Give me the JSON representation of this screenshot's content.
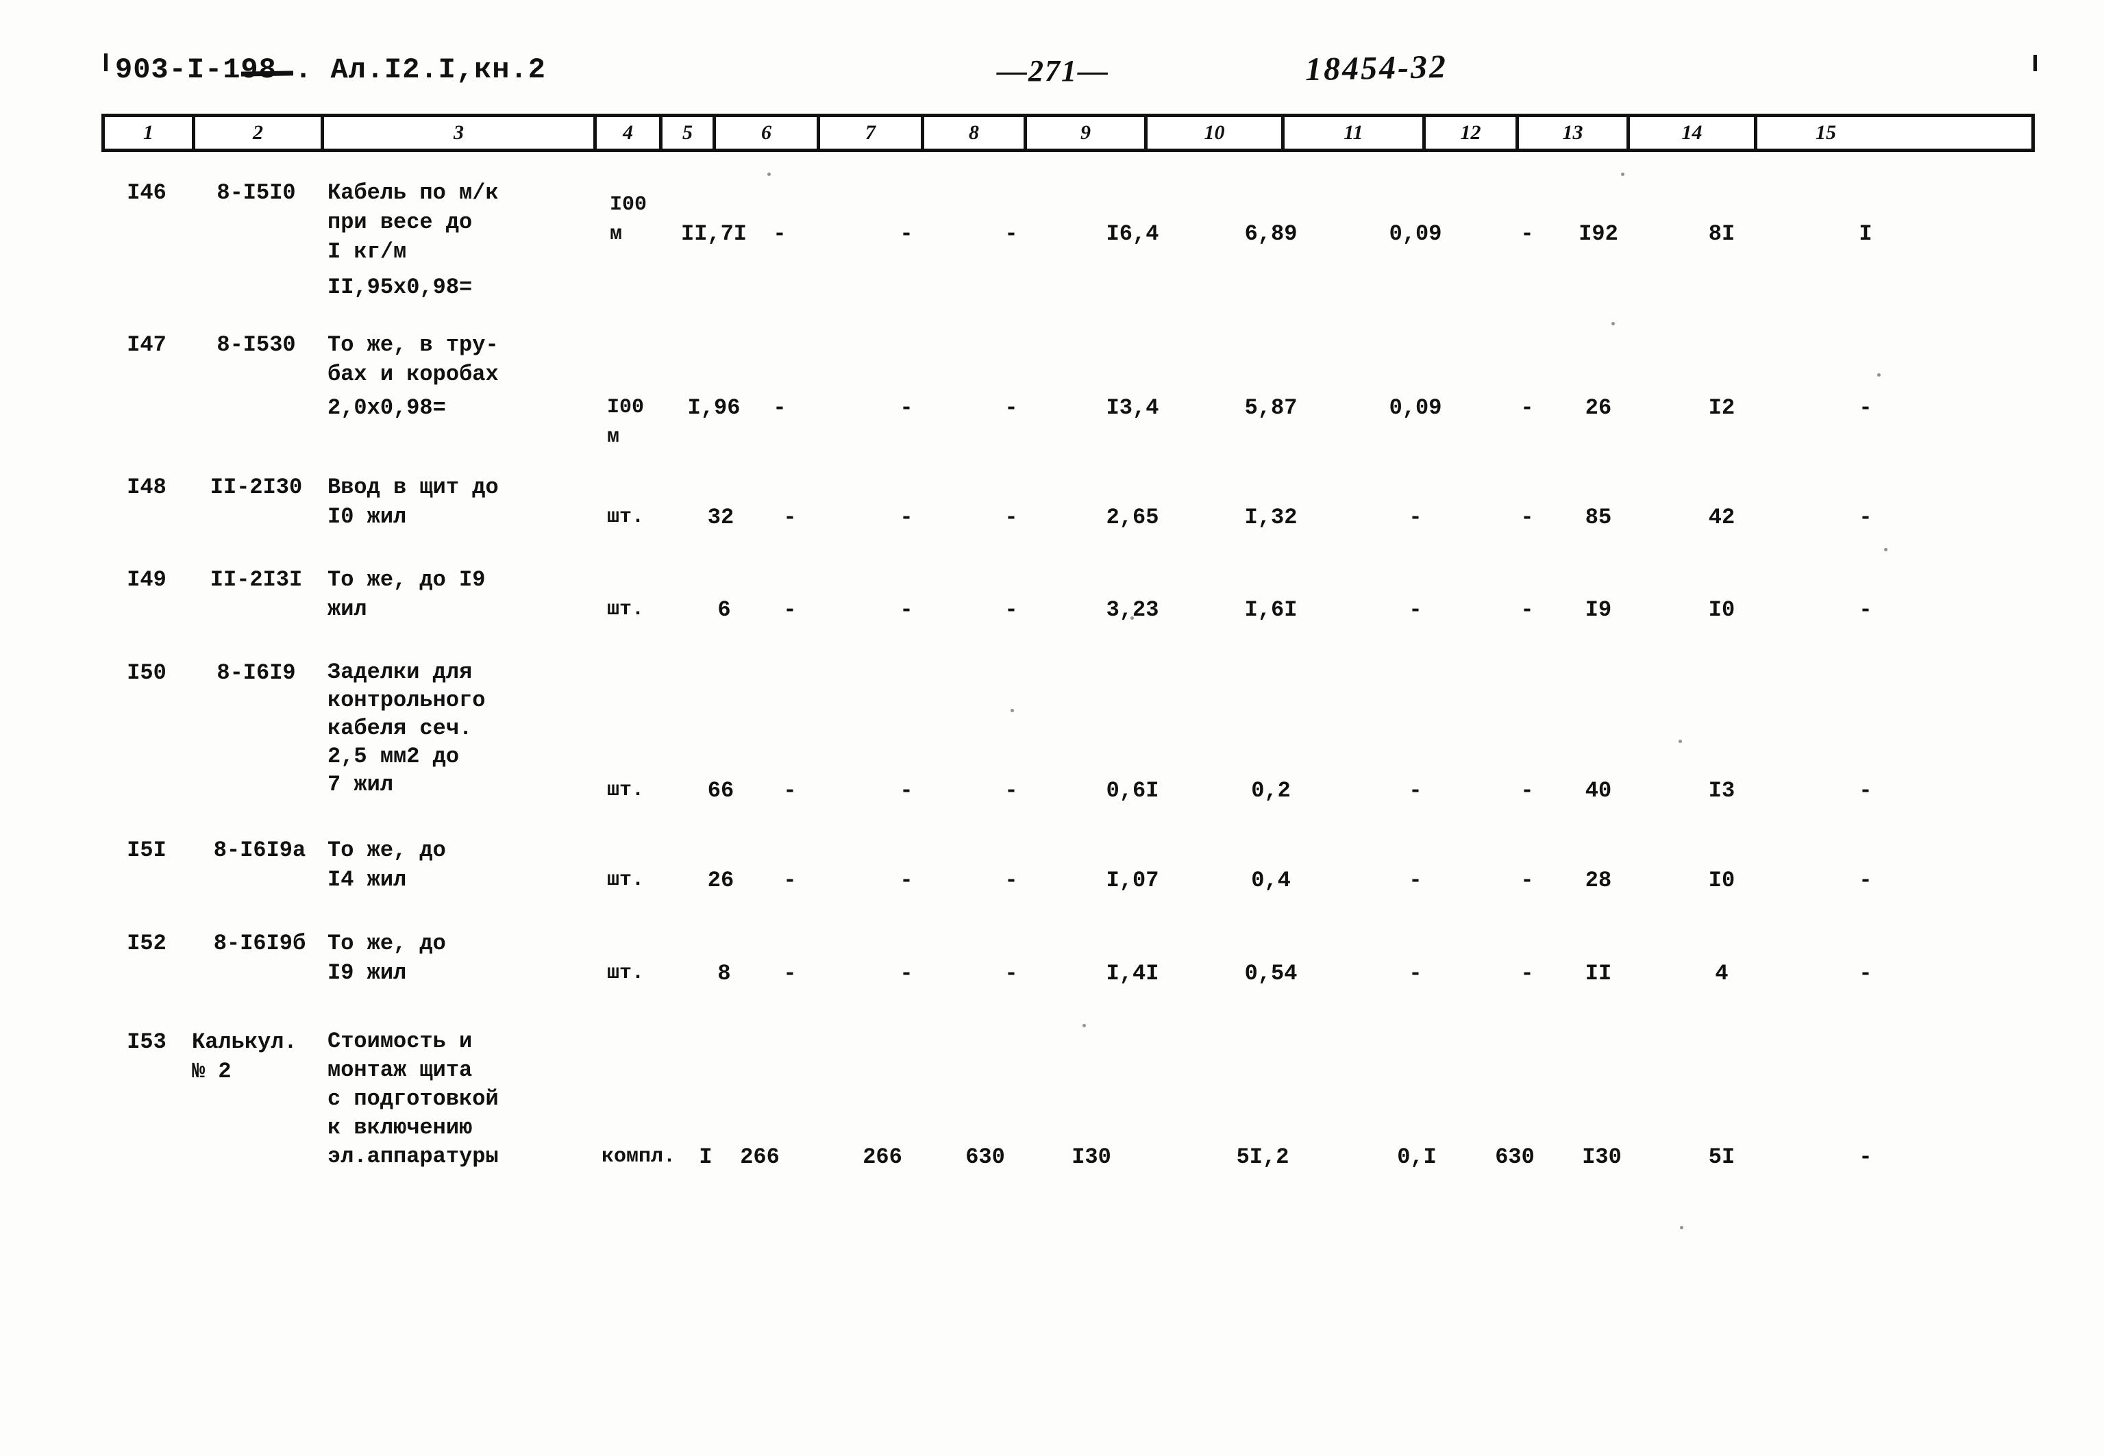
{
  "header": {
    "doc_code": "903-I-198 . Ал.I2.I,кн.2",
    "page_number": "—271—",
    "stamp": "18454-32"
  },
  "table": {
    "column_headers": [
      "1",
      "2",
      "3",
      "4",
      "5",
      "6",
      "7",
      "8",
      "9",
      "10",
      "11",
      "12",
      "13",
      "14",
      "15"
    ],
    "rows": [
      {
        "pos": "I46",
        "code": "8-I5I0",
        "description": "Кабель по м/к\nпри весе до\nI кг/м",
        "formula": "II,95х0,98=",
        "unit": "I00\nм",
        "qty": "II,7I",
        "c6": "-",
        "c7": "-",
        "c8": "-",
        "c9": "I6,4",
        "c10": "6,89",
        "c11": "0,09",
        "c12": "-",
        "c13": "I92",
        "c14": "8I",
        "c15": "I"
      },
      {
        "pos": "I47",
        "code": "8-I530",
        "description": "То же, в тру-\nбах и коробах",
        "formula": "2,0х0,98=",
        "unit": "I00\nм",
        "qty": "I,96",
        "c6": "-",
        "c7": "-",
        "c8": "-",
        "c9": "I3,4",
        "c10": "5,87",
        "c11": "0,09",
        "c12": "-",
        "c13": "26",
        "c14": "I2",
        "c15": "-"
      },
      {
        "pos": "I48",
        "code": "II-2I30",
        "description": "Ввод в щит до\nI0 жил",
        "formula": "",
        "unit": "шт.",
        "qty": "32",
        "c6": "-",
        "c7": "-",
        "c8": "-",
        "c9": "2,65",
        "c10": "I,32",
        "c11": "-",
        "c12": "-",
        "c13": "85",
        "c14": "42",
        "c15": "-"
      },
      {
        "pos": "I49",
        "code": "II-2I3I",
        "description": "То же, до I9\nжил",
        "formula": "",
        "unit": "шт.",
        "qty": "6",
        "c6": "-",
        "c7": "-",
        "c8": "-",
        "c9": "3,23",
        "c10": "I,6I",
        "c11": "-",
        "c12": "-",
        "c13": "I9",
        "c14": "I0",
        "c15": "-"
      },
      {
        "pos": "I50",
        "code": "8-I6I9",
        "description": "Заделки для\nконтрольного\nкабеля сеч.\n2,5 мм2 до\n7 жил",
        "formula": "",
        "unit": "шт.",
        "qty": "66",
        "c6": "-",
        "c7": "-",
        "c8": "-",
        "c9": "0,6I",
        "c10": "0,2",
        "c11": "-",
        "c12": "-",
        "c13": "40",
        "c14": "I3",
        "c15": "-"
      },
      {
        "pos": "I5I",
        "code": "8-I6I9а",
        "description": "То же, до\nI4 жил",
        "formula": "",
        "unit": "шт.",
        "qty": "26",
        "c6": "-",
        "c7": "-",
        "c8": "-",
        "c9": "I,07",
        "c10": "0,4",
        "c11": "-",
        "c12": "-",
        "c13": "28",
        "c14": "I0",
        "c15": "-"
      },
      {
        "pos": "I52",
        "code": "8-I6I9б",
        "description": "То же, до\nI9 жил",
        "formula": "",
        "unit": "шт.",
        "qty": "8",
        "c6": "-",
        "c7": "-",
        "c8": "-",
        "c9": "I,4I",
        "c10": "0,54",
        "c11": "-",
        "c12": "-",
        "c13": "II",
        "c14": "4",
        "c15": "-"
      },
      {
        "pos": "I53",
        "code": "Калькул.\n№ 2",
        "description": "Стоимость и\nмонтаж щита\nс подготовкой\nк включению\nэл.аппаратуры",
        "formula": "",
        "unit": "компл.",
        "qty": "I",
        "c6": "266",
        "c7": "266",
        "c8": "630",
        "c9": "I30",
        "c10": "5I,2",
        "c11": "0,I",
        "c12": "630",
        "c13": "I30",
        "c14": "5I",
        "c15": "-"
      }
    ]
  }
}
